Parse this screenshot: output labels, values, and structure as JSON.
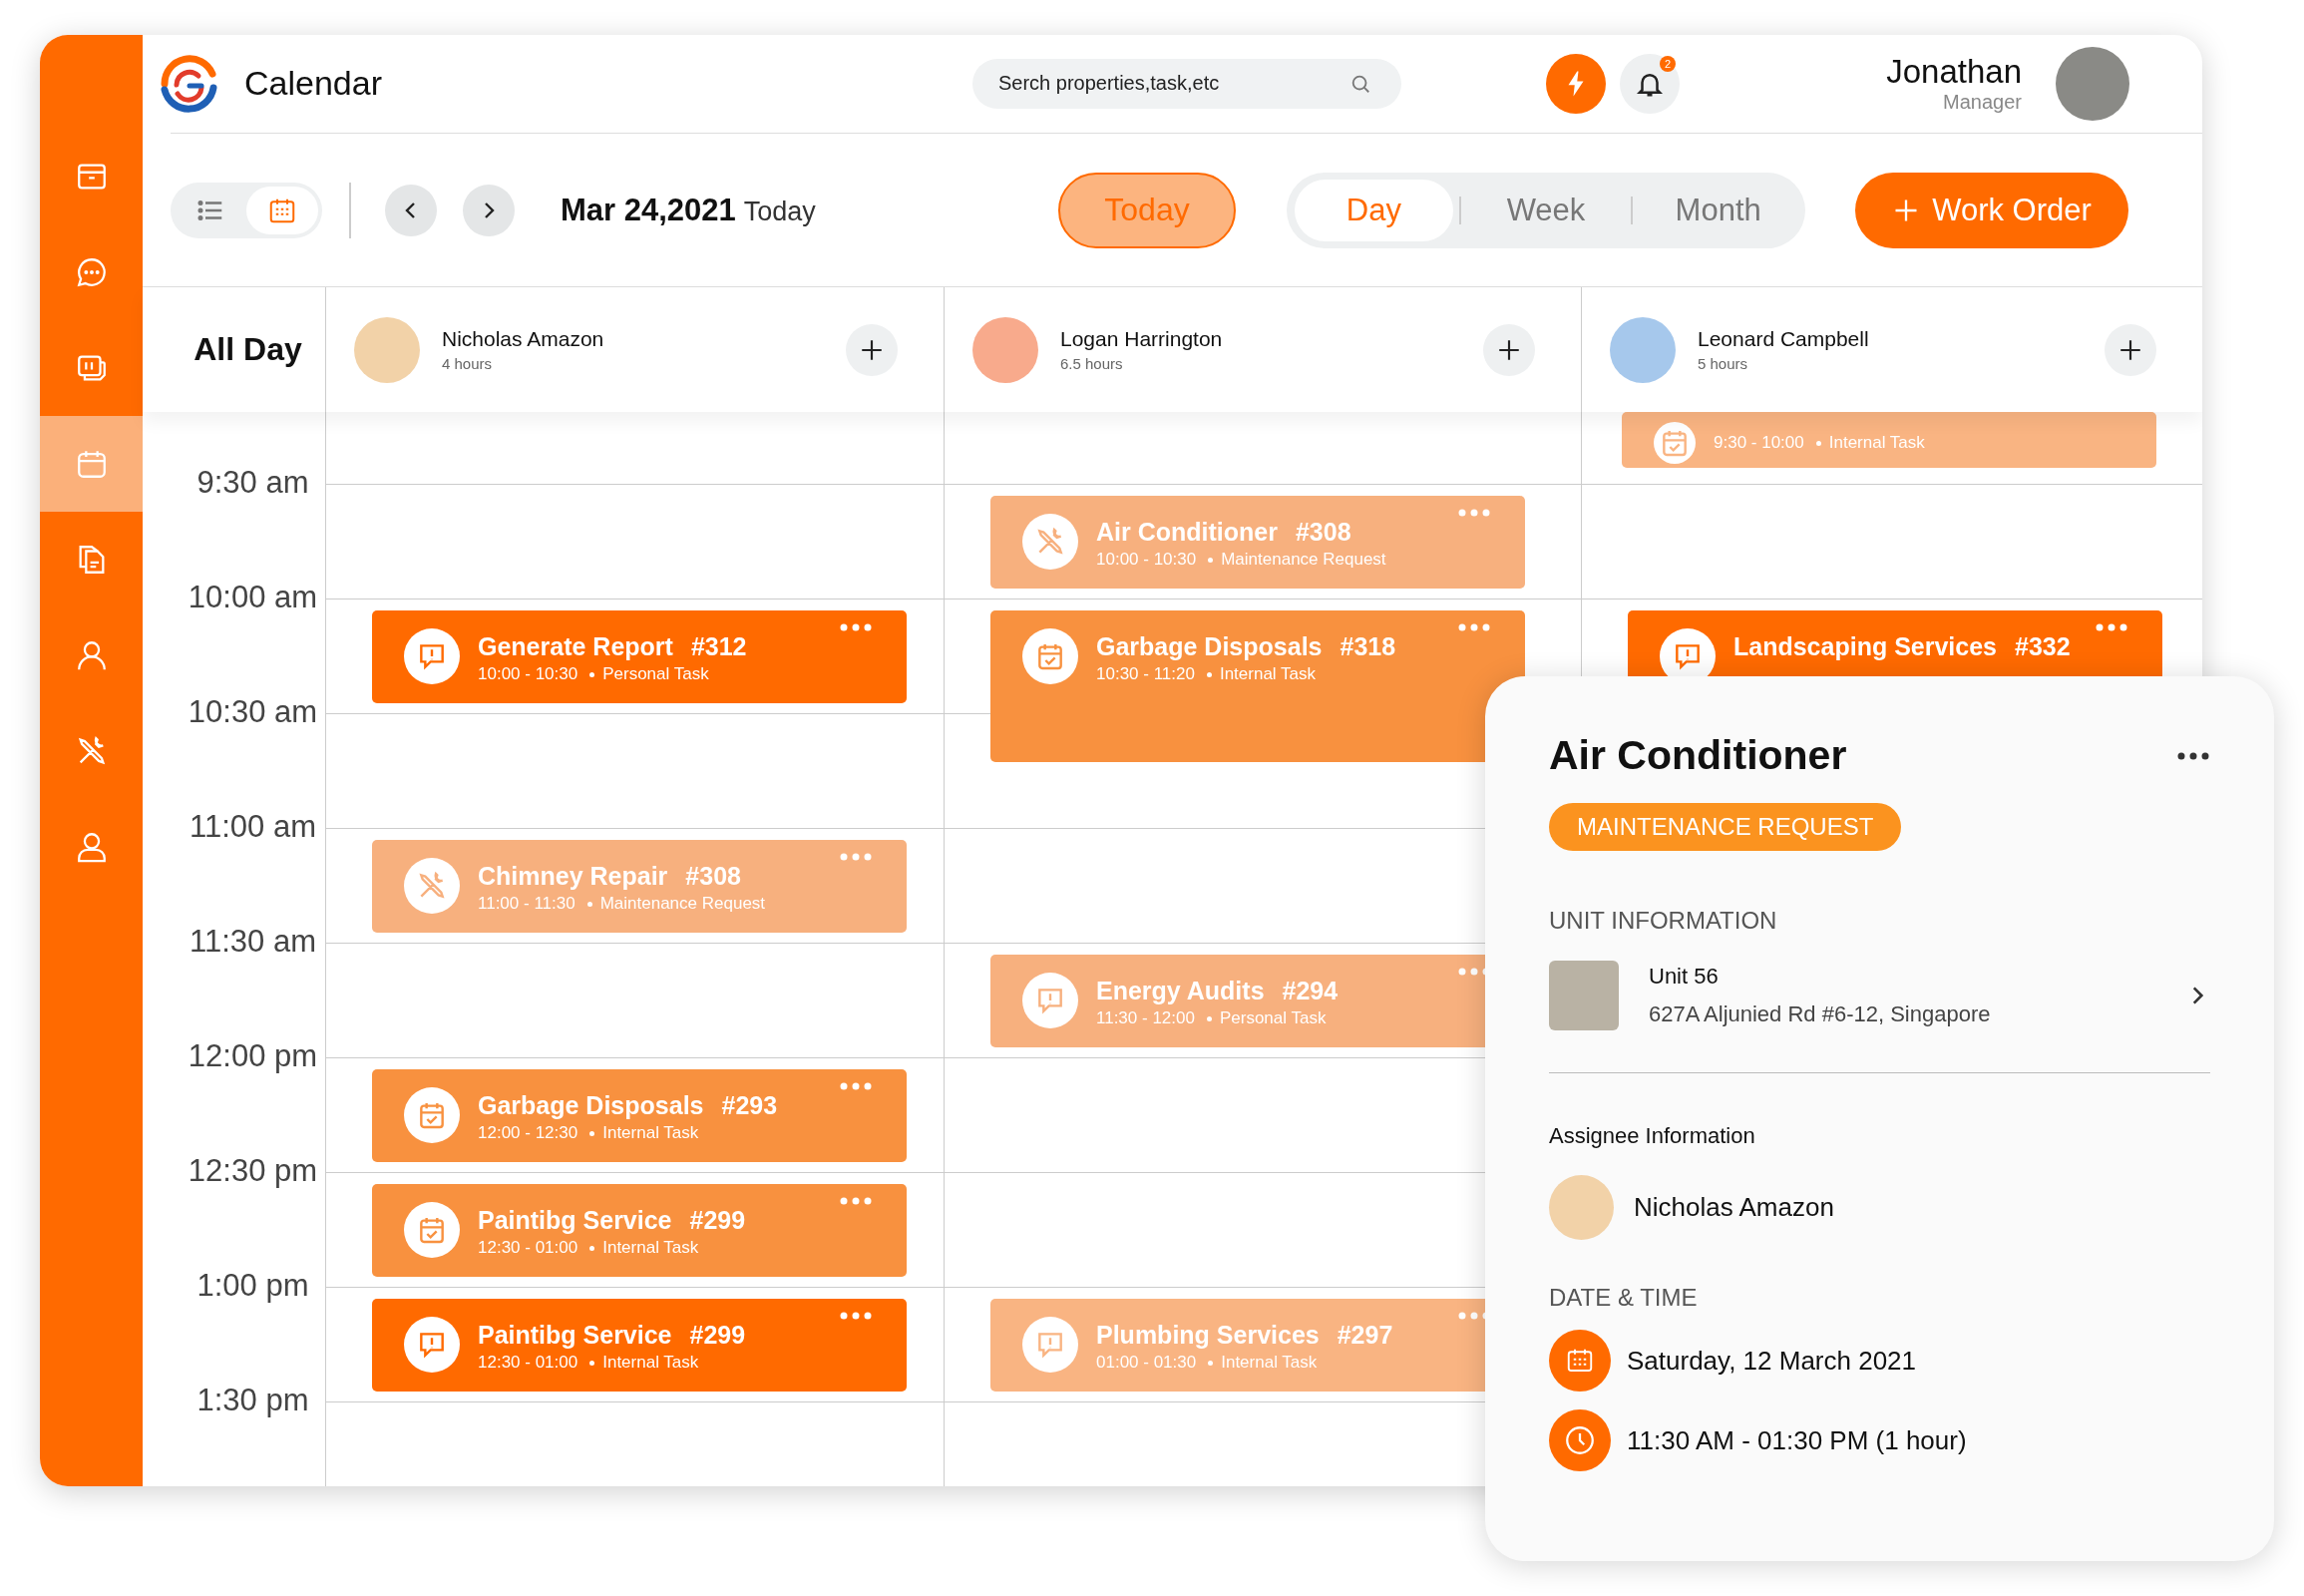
{
  "app": {
    "title": "Calendar"
  },
  "search": {
    "placeholder": "Serch properties,task,etc"
  },
  "notifications": {
    "count": "2"
  },
  "user": {
    "name": "Jonathan",
    "role": "Manager"
  },
  "sidebar": {
    "items": [
      {
        "kind": "archive",
        "selected": false
      },
      {
        "kind": "chat",
        "selected": false
      },
      {
        "kind": "cards",
        "selected": false
      },
      {
        "kind": "calendar",
        "selected": true
      },
      {
        "kind": "documents",
        "selected": false
      },
      {
        "kind": "person",
        "selected": false
      },
      {
        "kind": "tools",
        "selected": false
      },
      {
        "kind": "user",
        "selected": false
      }
    ]
  },
  "toolbar": {
    "views": [
      {
        "kind": "list",
        "selected": false
      },
      {
        "kind": "calendar",
        "selected": true
      }
    ],
    "date": "Mar 24,2021",
    "date_note": "Today",
    "today_button": "Today",
    "ranges": [
      {
        "label": "Day",
        "selected": true
      },
      {
        "label": "Week",
        "selected": false
      },
      {
        "label": "Month",
        "selected": false
      }
    ],
    "work_order_button": "Work Order"
  },
  "all_day_label": "All Day",
  "times": [
    "9:30 am",
    "10:00 am",
    "10:30 am",
    "11:00 am",
    "11:30 am",
    "12:00 pm",
    "12:30 pm",
    "1:00 pm",
    "1:30 pm"
  ],
  "columns": [
    {
      "name": "Nicholas Amazon",
      "hours": "4 hours",
      "color": "#f2d2a8",
      "events": [
        {
          "title": "Generate Report",
          "number": "#312",
          "time": "10:00 - 10:30",
          "type": "Personal Task",
          "kind": "alert",
          "color": "#ff6a00"
        },
        {
          "title": "Chimney Repair",
          "number": "#308",
          "time": "11:00 - 11:30",
          "type": "Maintenance Request",
          "kind": "tools",
          "color": "#f7b07e"
        },
        {
          "title": "Garbage Disposals",
          "number": "#293",
          "time": "12:00 - 12:30",
          "type": "Internal Task",
          "kind": "task",
          "color": "#f8913f"
        },
        {
          "title": "Paintibg Service",
          "number": "#299",
          "time": "12:30 - 01:00",
          "type": "Internal Task",
          "kind": "task",
          "color": "#f8913f"
        },
        {
          "title": "Paintibg Service",
          "number": "#299",
          "time": "12:30 - 01:00",
          "type": "Internal Task",
          "kind": "alert",
          "color": "#ff6a00"
        }
      ]
    },
    {
      "name": "Logan Harrington",
      "hours": "6.5 hours",
      "color": "#f8aa8c",
      "events": [
        {
          "title": "Air Conditioner",
          "number": "#308",
          "time": "10:00 - 10:30",
          "type": "Maintenance Request",
          "kind": "tools",
          "color": "#f7b07e"
        },
        {
          "title": "Garbage Disposals",
          "number": "#318",
          "time": "10:30 - 11:20",
          "type": "Internal Task",
          "kind": "task",
          "color": "#f8913f"
        },
        {
          "title": "Energy Audits",
          "number": "#294",
          "time": "11:30 - 12:00",
          "type": "Personal Task",
          "kind": "alert",
          "color": "#f7b07e"
        },
        {
          "title": "Plumbing Services",
          "number": "#297",
          "time": "01:00 - 01:30",
          "type": "Internal Task",
          "kind": "alert",
          "color": "#f9b482"
        }
      ]
    },
    {
      "name": "Leonard Campbell",
      "hours": "5 hours",
      "color": "#a6c8ec",
      "events": [
        {
          "time": "9:30 - 10:00",
          "type": "Internal Task",
          "kind": "task",
          "color": "#f9b482"
        },
        {
          "title": "Landscaping Services",
          "number": "#332",
          "kind": "alert",
          "color": "#ff6a00"
        }
      ]
    }
  ],
  "detail": {
    "title": "Air Conditioner",
    "badge": "MAINTENANCE REQUEST",
    "unit_heading": "UNIT INFORMATION",
    "unit_name": "Unit 56",
    "unit_address": "627A Aljunied Rd #6-12, Singapore",
    "assignee_heading": "Assignee Information",
    "assignee_name": "Nicholas Amazon",
    "datetime_heading": "DATE & TIME",
    "date": "Saturday, 12 March 2021",
    "time": "11:30 AM - 01:30 PM (1 hour)"
  }
}
